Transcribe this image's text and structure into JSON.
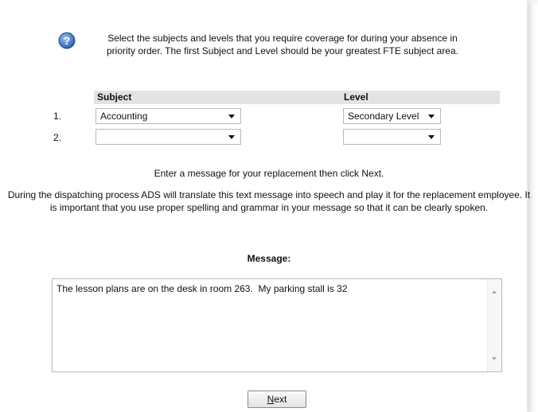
{
  "intro": {
    "line1": "Select the subjects and levels that you require coverage for during your absence in",
    "line2": "priority order. The first Subject and Level should be your greatest FTE subject area."
  },
  "grid": {
    "subject_header": "Subject",
    "level_header": "Level",
    "rows": [
      {
        "number": "1.",
        "subject": "Accounting",
        "level": "Secondary Level"
      },
      {
        "number": "2.",
        "subject": "",
        "level": ""
      }
    ]
  },
  "instruction": "Enter a message for your replacement then click Next.",
  "dispatch_note": {
    "line1": "During the dispatching process ADS will translate this text message into speech and play it for the replacement employee. It",
    "line2": "is important that you use proper spelling and grammar in your message so that it can be clearly spoken."
  },
  "message": {
    "label": "Message:",
    "value": "The lesson plans are on the desk in room 263.  My parking stall is 32"
  },
  "next_button": {
    "mnemonic": "N",
    "rest": "ext"
  },
  "colors": {
    "help_icon": "#3a6fc4",
    "header_bg": "#e3e3e3"
  }
}
